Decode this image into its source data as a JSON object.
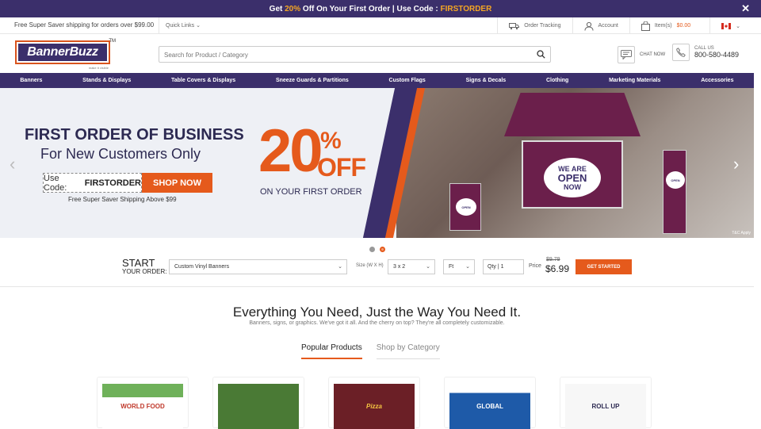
{
  "promo": {
    "prefix": "Get",
    "percent": "20%",
    "middle": "Off On Your First Order | Use Code :",
    "code": "FIRSTORDER"
  },
  "util": {
    "shipping": "Free Super Saver shipping for orders over $99.00",
    "quick_links": "Quick Links",
    "order_tracking": "Order Tracking",
    "account": "Account",
    "cart_label": "Item(s)",
    "cart_amount": "$0.00"
  },
  "header": {
    "logo_text": "BannerBuzz",
    "logo_tm": "TM",
    "logo_tagline": "make it visible",
    "search_placeholder": "Search for Product / Category",
    "chat": "CHAT NOW",
    "call_label": "CALL US",
    "call_number": "800-580-4489"
  },
  "nav": [
    "Banners",
    "Stands & Displays",
    "Table Covers & Displays",
    "Sneeze Guards & Partitions",
    "Custom Flags",
    "Signs & Decals",
    "Clothing",
    "Marketing Materials",
    "Accessories"
  ],
  "hero": {
    "headline": "FIRST ORDER OF BUSINESS",
    "subhead": "For New Customers Only",
    "code_label": "Use Code:",
    "code": "FIRSTORDER",
    "cta": "SHOP NOW",
    "shipping": "Free Super Saver Shipping Above $99",
    "big_number": "20",
    "percent": "%",
    "off": "OFF",
    "first_order": "ON YOUR FIRST ORDER",
    "tent_text_1": "WE ARE",
    "tent_text_2": "OPEN",
    "tent_text_3": "NOW",
    "tc": "T&C Apply"
  },
  "quick_order": {
    "title_1": "START",
    "title_2": "YOUR ORDER:",
    "product": "Custom Vinyl Banners",
    "size_label": "Size (W X H)",
    "size": "3 x 2",
    "unit": "Ft",
    "qty_label": "Qty |",
    "qty": "1",
    "price_label": "Price",
    "old_price": "$9.79",
    "new_price": "$6.99",
    "cta": "GET STARTED"
  },
  "section": {
    "title": "Everything You Need, Just the Way You Need It.",
    "subtitle": "Banners, signs, or graphics. We've got it all. And the cherry on top? They're all completely customizable.",
    "tabs": [
      "Popular Products",
      "Shop by Category"
    ]
  },
  "products": [
    {
      "label": "WORLD FOOD",
      "color": "#3aa84a"
    },
    {
      "label": "",
      "color": "#4a7a35"
    },
    {
      "label": "Pizza",
      "color": "#6b1f26"
    },
    {
      "label": "GLOBAL",
      "color": "#1e5aa8"
    },
    {
      "label": "ROLL UP",
      "color": "#f2f2f2"
    }
  ],
  "colors": {
    "brand": "#3b2f6b",
    "accent": "#e55a1c",
    "promo_highlight": "#f5a623"
  }
}
